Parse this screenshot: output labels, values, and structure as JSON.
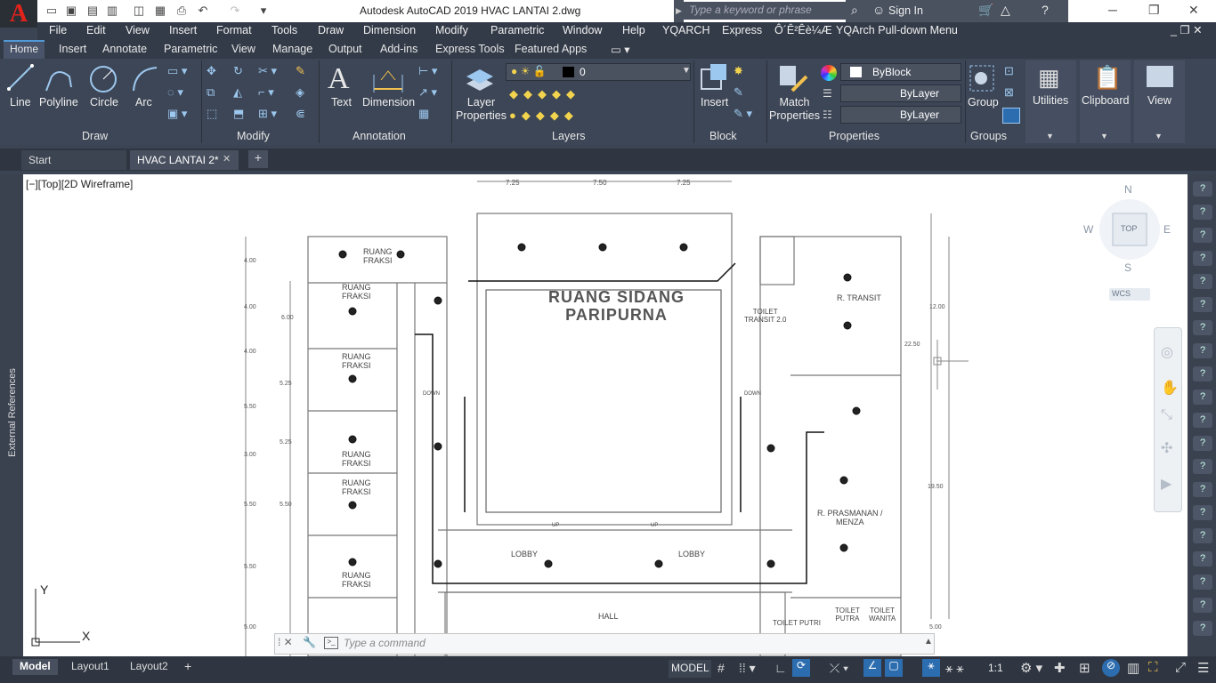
{
  "app": {
    "title": "Autodesk AutoCAD 2019    HVAC LANTAI 2.dwg",
    "logo_letter": "A",
    "search_placeholder": "Type a keyword or phrase",
    "sign_in": "Sign In"
  },
  "menu": [
    "File",
    "Edit",
    "View",
    "Insert",
    "Format",
    "Tools",
    "Draw",
    "Dimension",
    "Modify",
    "Parametric",
    "Window",
    "Help",
    "YQARCH",
    "Express",
    "Ô´Ê²Êè¼Æ",
    "YQArch Pull-down Menu"
  ],
  "ribbon_tabs": [
    "Home",
    "Insert",
    "Annotate",
    "Parametric",
    "View",
    "Manage",
    "Output",
    "Add-ins",
    "Express Tools",
    "Featured Apps"
  ],
  "draw": {
    "line": "Line",
    "polyline": "Polyline",
    "circle": "Circle",
    "arc": "Arc",
    "title": "Draw"
  },
  "modify": {
    "title": "Modify"
  },
  "annotation": {
    "text": "Text",
    "dimension": "Dimension",
    "title": "Annotation"
  },
  "layers": {
    "properties": "Layer\nProperties",
    "current_layer": "0",
    "title": "Layers"
  },
  "block": {
    "insert": "Insert",
    "title": "Block"
  },
  "properties": {
    "match": "Match\nProperties",
    "color": "ByBlock",
    "linetype": "ByLayer",
    "lineweight": "ByLayer",
    "title": "Properties"
  },
  "groups": {
    "group": "Group",
    "title": "Groups"
  },
  "utilities": "Utilities",
  "clipboard": "Clipboard",
  "view": "View",
  "file_tabs": {
    "start": "Start",
    "drawing": "HVAC LANTAI 2*"
  },
  "left_sidebar": "External References",
  "viewport": {
    "label": "[−][Top][2D Wireframe]",
    "viewcube_top": "TOP",
    "north": "N",
    "south": "S",
    "east": "E",
    "west": "W",
    "wcs": "WCS"
  },
  "drawing_text": {
    "main_room": "RUANG SIDANG\nPARIPURNA",
    "fraksi": "RUANG\nFRAKSI",
    "transit": "R. TRANSIT",
    "prasmanan": "R. PRASMANAN /\nMENZA",
    "lobby": "LOBBY",
    "hall": "HALL",
    "toilet_putri": "TOILET PUTRI",
    "toilet_putra": "TOILET\nPUTRA",
    "toilet_wanita": "TOILET\nWANITA",
    "toilet_transit": "TOILET\nTRANSIT 2.0",
    "down": "DOWN",
    "up": "UP",
    "dims_top": [
      "7.25",
      "7.50",
      "7.25"
    ],
    "dims_left": [
      "4.00",
      "4.00",
      "4.00",
      "5.50",
      "3.00",
      "5.50",
      "5.50",
      "5.00"
    ],
    "dims_left2": [
      "6.00",
      "5.25",
      "5.25",
      "5.50"
    ],
    "dims_right": [
      "12.00",
      "22.50",
      "19.50",
      "5.00"
    ]
  },
  "command": {
    "placeholder": "Type a command"
  },
  "layout_tabs": [
    "Model",
    "Layout1",
    "Layout2"
  ],
  "status": {
    "model": "MODEL",
    "scale": "1:1"
  }
}
